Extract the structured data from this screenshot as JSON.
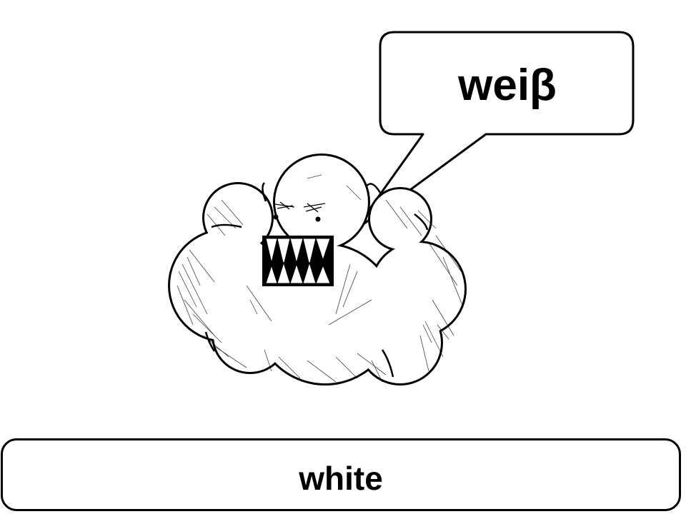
{
  "speech_bubble": {
    "text": "weiβ"
  },
  "caption": {
    "text": "white"
  },
  "illustration": {
    "subject": "cloud-monster-icon",
    "colors": {
      "fill": "#ffffff",
      "outline": "#000000",
      "teeth": "#ffffff",
      "mouth": "#000000"
    }
  }
}
